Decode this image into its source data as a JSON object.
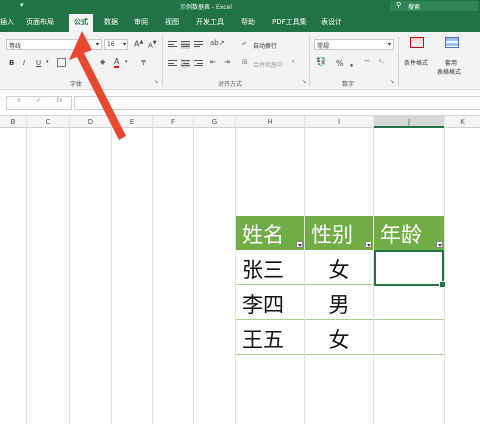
{
  "titlebar": {
    "title": "示例数据表 - Excel",
    "search_label": "搜索"
  },
  "tabs": [
    "插入",
    "页面布局",
    "公式",
    "数据",
    "审阅",
    "视图",
    "开发工具",
    "帮助",
    "PDF工具集",
    "表设计"
  ],
  "active_tab": "公式",
  "ribbon": {
    "font_name": "等线",
    "font_size": "16",
    "number_format": "常规",
    "wrap_text": "自动换行",
    "merge_center": "合并后居中",
    "conditional_format": "条件格式",
    "apply": "套用",
    "table_format": "表格格式",
    "group_font": "字体",
    "group_align": "对齐方式",
    "group_number": "数字",
    "bold": "B",
    "italic": "I",
    "underline": "U",
    "font_color_letter": "A",
    "percent": "%"
  },
  "formula_bar": {
    "fx": "fx",
    "cancel": "×",
    "enter": "✓"
  },
  "columns": [
    "B",
    "C",
    "D",
    "E",
    "F",
    "G",
    "H",
    "I",
    "J",
    "K"
  ],
  "selected_column": "J",
  "table": {
    "headers": [
      "姓名",
      "性别",
      "年龄"
    ],
    "rows": [
      [
        "张三",
        "女",
        ""
      ],
      [
        "李四",
        "男",
        ""
      ],
      [
        "王五",
        "女",
        ""
      ]
    ]
  },
  "colors": {
    "excel_green": "#217346",
    "header_fill": "#70ad47",
    "arrow": "#e8482f"
  }
}
